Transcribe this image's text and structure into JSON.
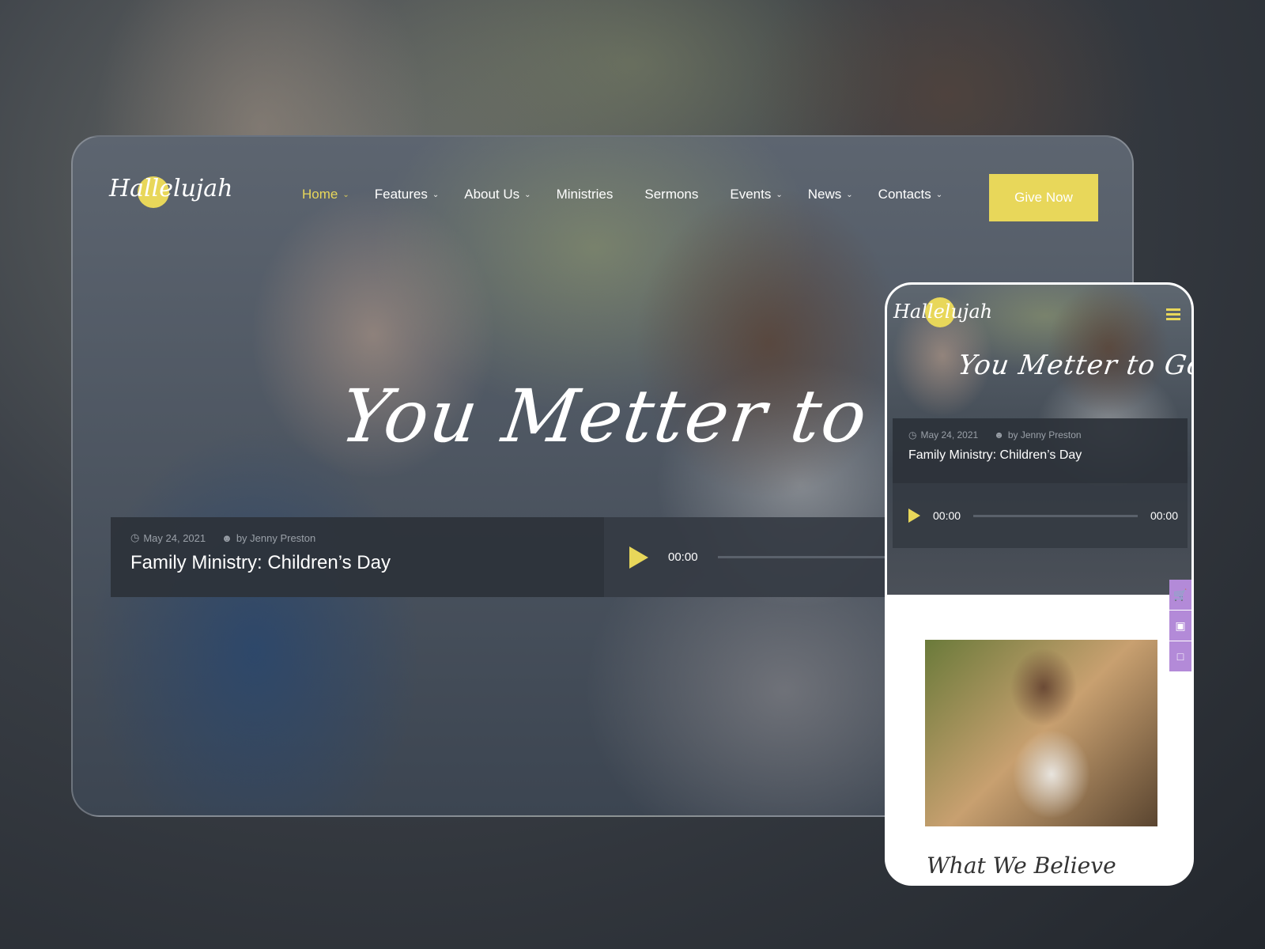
{
  "brand": {
    "logo": "Hallelujah",
    "accent": "#e8d75a",
    "side_accent": "#b38ad8"
  },
  "nav": {
    "items": [
      {
        "label": "Home",
        "dropdown": true,
        "active": true
      },
      {
        "label": "Features",
        "dropdown": true
      },
      {
        "label": "About Us",
        "dropdown": true
      },
      {
        "label": "Ministries",
        "dropdown": false
      },
      {
        "label": "Sermons",
        "dropdown": false
      },
      {
        "label": "Events",
        "dropdown": true
      },
      {
        "label": "News",
        "dropdown": true
      },
      {
        "label": "Contacts",
        "dropdown": true
      }
    ],
    "cta": "Give Now"
  },
  "hero": {
    "title": "You Metter to God"
  },
  "post": {
    "date": "May 24, 2021",
    "author": "by Jenny Preston",
    "title": "Family Ministry: Children’s Day"
  },
  "player": {
    "current": "00:00",
    "duration": "00:00",
    "progress": 0
  },
  "mobile": {
    "section_title": "What We Believe",
    "side_icons": [
      "cart-icon",
      "image-icon",
      "window-icon"
    ]
  }
}
